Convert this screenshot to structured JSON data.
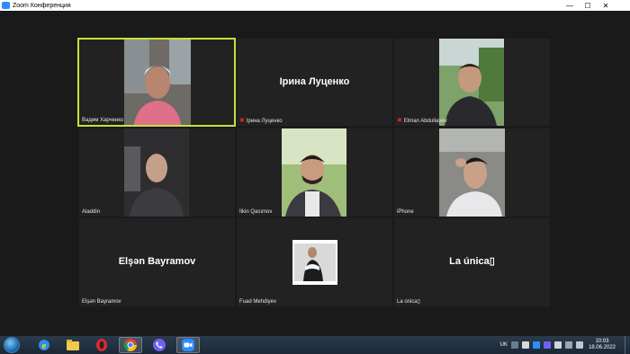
{
  "window": {
    "title": "Zoom Конференция",
    "minimize": "—",
    "maximize": "☐",
    "close": "✕"
  },
  "participants": [
    {
      "name": "Вадим Харченко",
      "type": "video",
      "active": true,
      "muted": false
    },
    {
      "name": "Ірина Луценко",
      "type": "name",
      "display": "Ірина Луценко",
      "muted": true
    },
    {
      "name": "Elman Abdullayev",
      "type": "video",
      "muted": true
    },
    {
      "name": "Aladdin",
      "type": "video",
      "muted": false
    },
    {
      "name": "İlkin Qasımov",
      "type": "video",
      "muted": false
    },
    {
      "name": "iPhone",
      "type": "video",
      "muted": false
    },
    {
      "name": "Elşən Bayramov",
      "type": "name",
      "display": "Elşən Bayramov",
      "muted": false
    },
    {
      "name": "Fuad Mehdiyev",
      "type": "video",
      "muted": false
    },
    {
      "name": "La única▯",
      "type": "name",
      "display": "La única▯",
      "muted": false
    }
  ],
  "taskbar": {
    "apps": [
      "internet-explorer-icon",
      "file-explorer-icon",
      "opera-icon",
      "chrome-icon",
      "viber-icon",
      "zoom-icon"
    ],
    "language": "UK",
    "time": "10:03",
    "date": "18.06.2022"
  },
  "colors": {
    "active_border": "#c8e03b",
    "tile_bg": "#222222",
    "stage_bg": "#1a1a1a",
    "muted_mic": "#e02828"
  }
}
